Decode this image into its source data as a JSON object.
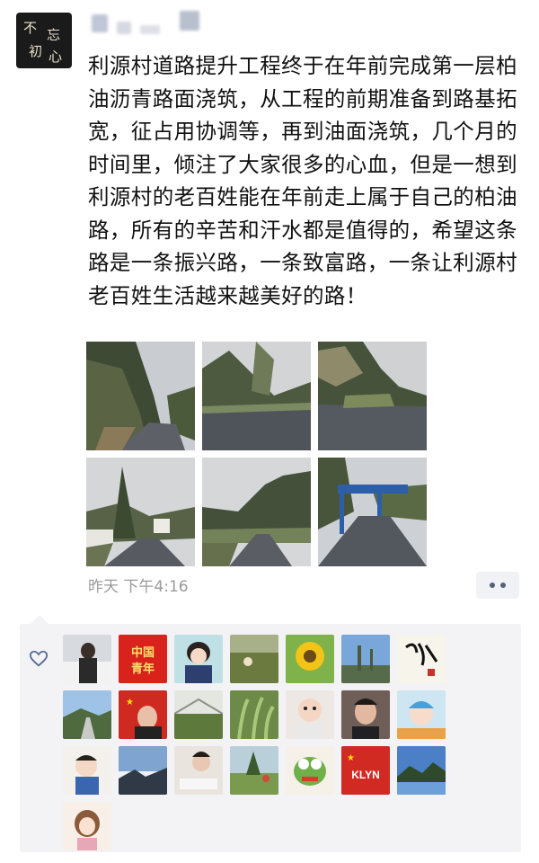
{
  "post": {
    "text": "利源村道路提升工程终于在年前完成第一层柏油沥青路面浇筑，从工程的前期准备到路基拓宽，征占用协调等，再到油面浇筑，几个月的时间里，倾注了大家很多的心血，但是一想到利源村的老百姓能在年前走上属于自己的柏油路，所有的辛苦和汗水都是值得的，希望这条路是一条振兴路，一条致富路，一条让利源村老百姓生活越来越美好的路！",
    "timestamp": "昨天 下午4:16"
  },
  "avatar_text": [
    "不",
    "忘",
    "初",
    "心"
  ],
  "photos": [
    "road-hill-photo",
    "road-curve-photo",
    "road-embankment-photo",
    "village-road-photo",
    "valley-road-photo",
    "road-gate-photo"
  ],
  "likers": {
    "row1": [
      "person-snow",
      "china-youth",
      "anime-girl",
      "field",
      "sunflower",
      "trees-sky",
      "calligraphy"
    ],
    "row2": [
      "road-view",
      "flag-person",
      "greenhouse",
      "plants",
      "baby",
      "man-portrait",
      "baby-cap"
    ],
    "row3": [
      "baby-sitting",
      "sea-clouds",
      "reading-girl",
      "garden",
      "cartoon-frog",
      "flag-logo",
      "mountain-lake"
    ],
    "row4": [
      "cartoon-girl"
    ]
  },
  "liker_text": {
    "china_youth": "中国青年",
    "logo": "KLYN"
  },
  "colors": {
    "link_blue": "#576b95",
    "time_grey": "#9a9a9a",
    "panel_bg": "#f3f3f5"
  }
}
